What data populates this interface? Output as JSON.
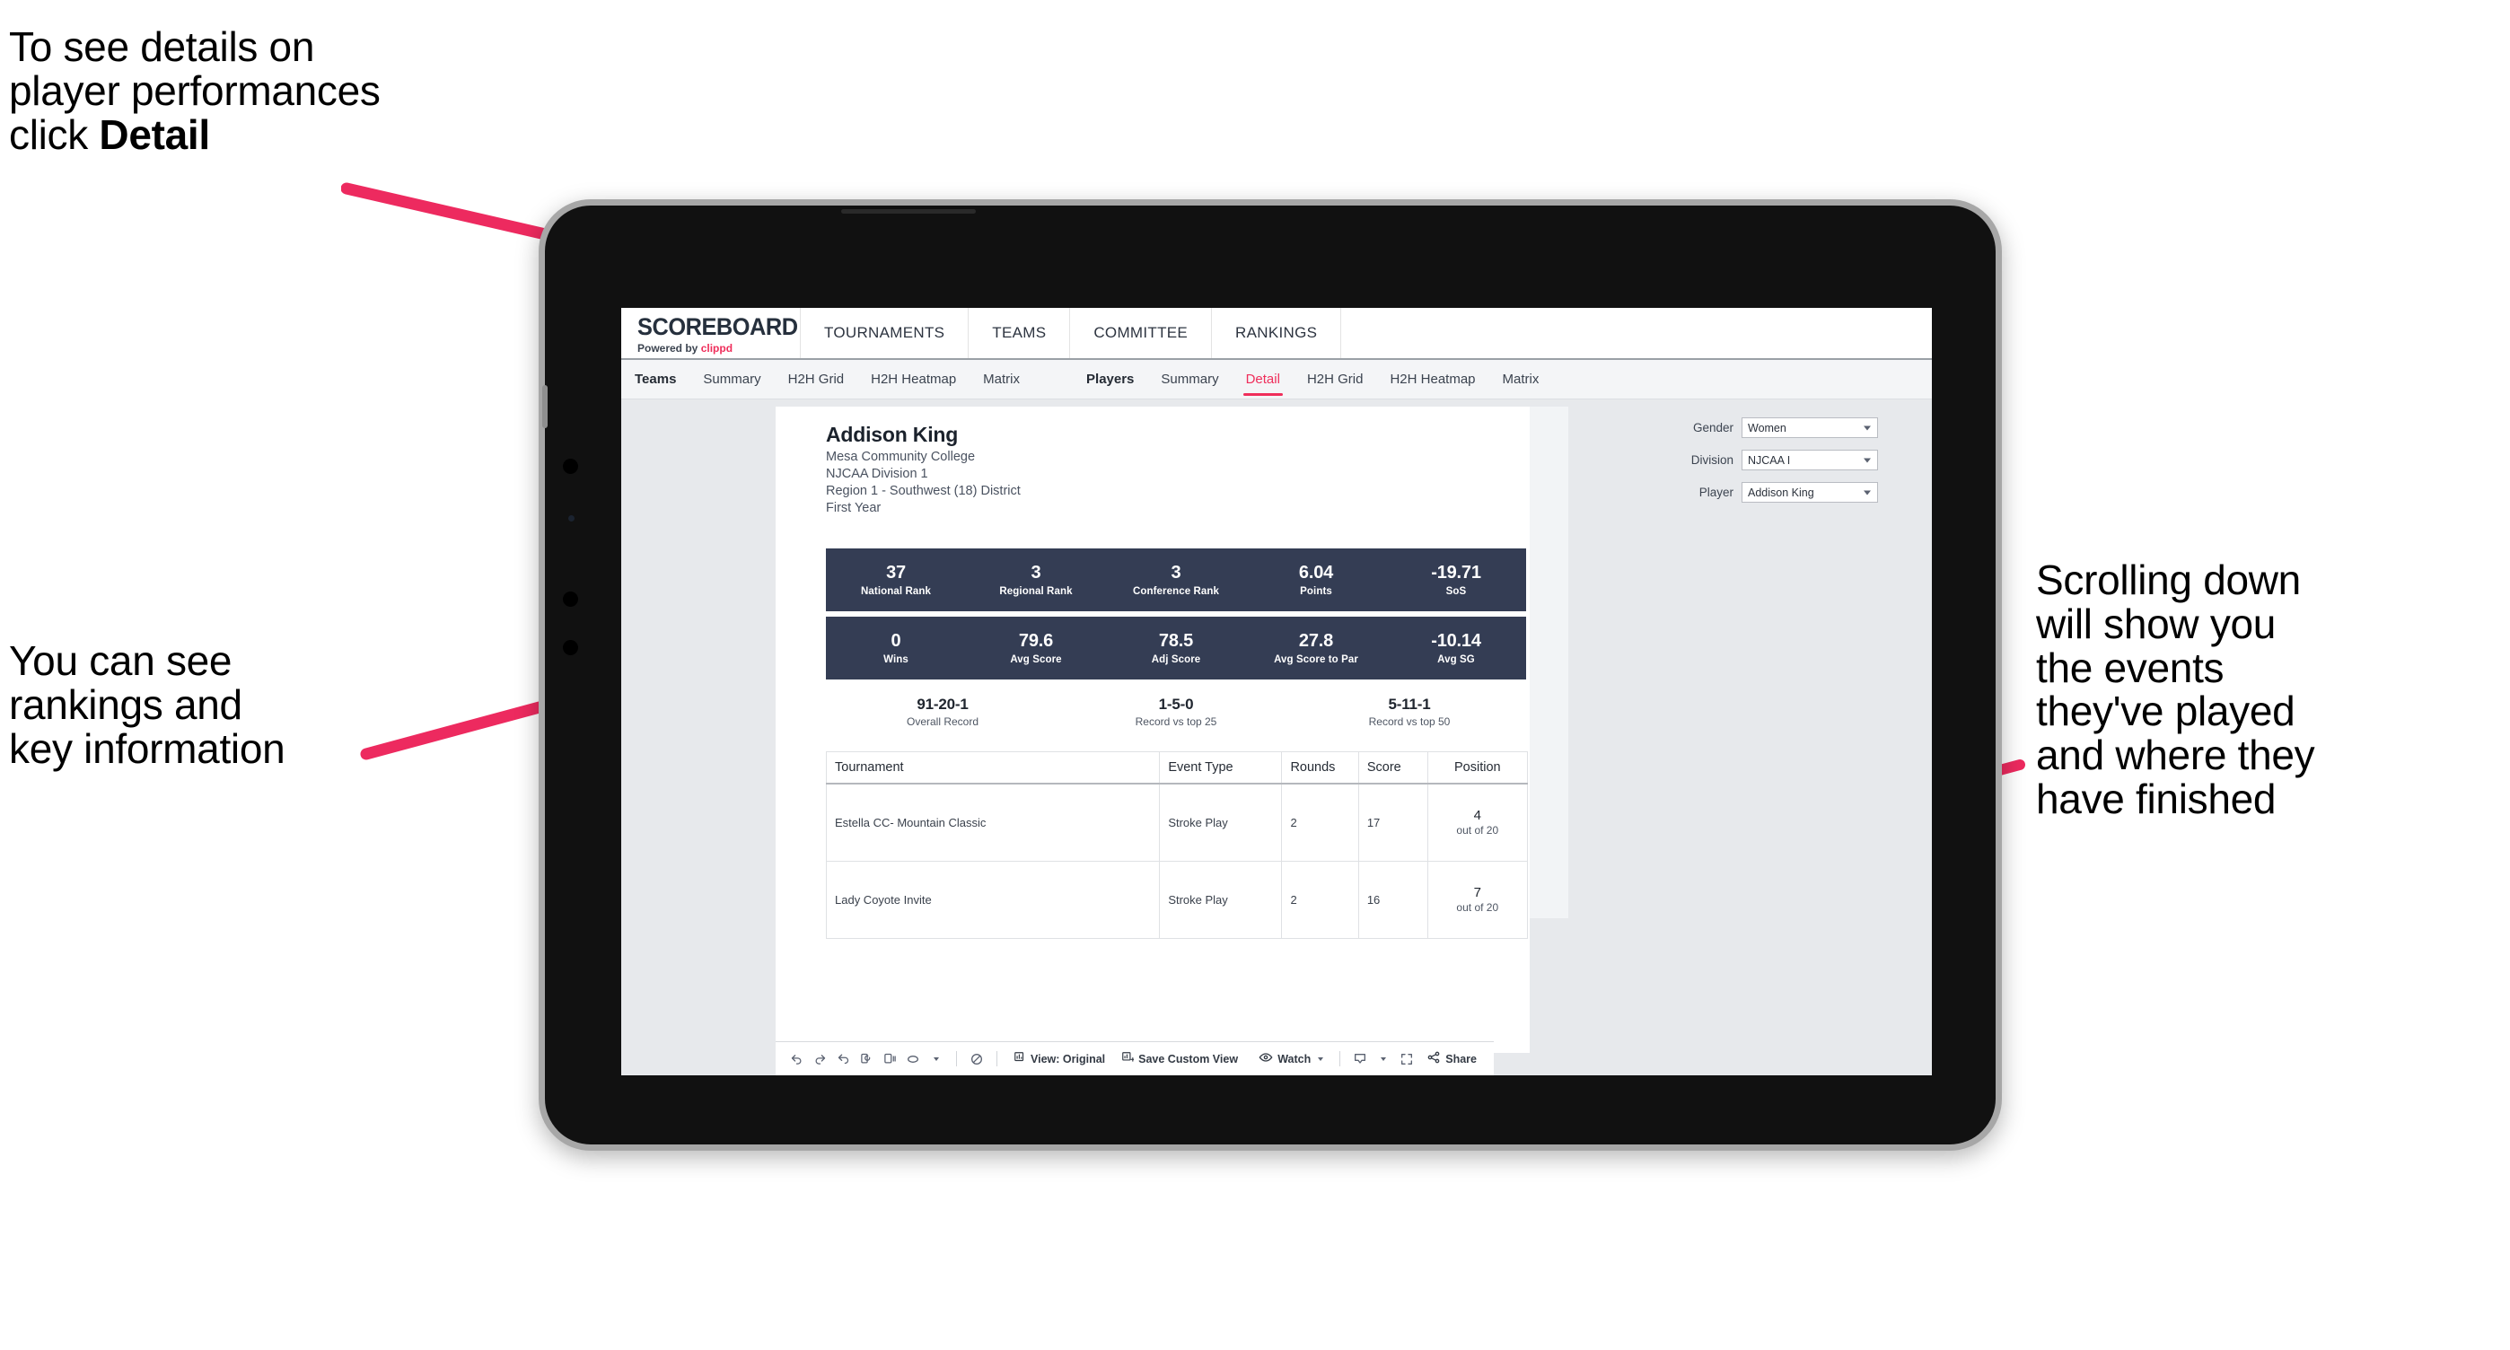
{
  "annotations": {
    "detail_hint_prefix": "To see details on\nplayer performances\nclick ",
    "detail_hint_bold": "Detail",
    "rankings_hint": "You can see\nrankings and\nkey information",
    "scroll_hint": "Scrolling down\nwill show you\nthe events\nthey've played\nand where they\nhave finished",
    "arrow_color": "#ED2A5F"
  },
  "app": {
    "logo_word": "SCOREBOARD",
    "logo_sub_prefix": "Powered by ",
    "logo_brand": "clippd",
    "top_nav": [
      "TOURNAMENTS",
      "TEAMS",
      "COMMITTEE",
      "RANKINGS"
    ],
    "sub_nav_teams": [
      "Teams",
      "Summary",
      "H2H Grid",
      "H2H Heatmap",
      "Matrix"
    ],
    "sub_nav_players": [
      "Players",
      "Summary",
      "Detail",
      "H2H Grid",
      "H2H Heatmap",
      "Matrix"
    ],
    "active_sub_tab": "Detail",
    "accent_color": "#EF2E5B"
  },
  "player": {
    "name": "Addison King",
    "school": "Mesa Community College",
    "division": "NJCAA Division 1",
    "region": "Region 1 - Southwest (18) District",
    "year": "First Year"
  },
  "filters": [
    {
      "label": "Gender",
      "value": "Women"
    },
    {
      "label": "Division",
      "value": "NJCAA I"
    },
    {
      "label": "Player",
      "value": "Addison King"
    }
  ],
  "stats_row_1": [
    {
      "value": "37",
      "label": "National Rank"
    },
    {
      "value": "3",
      "label": "Regional Rank"
    },
    {
      "value": "3",
      "label": "Conference Rank"
    },
    {
      "value": "6.04",
      "label": "Points"
    },
    {
      "value": "-19.71",
      "label": "SoS"
    }
  ],
  "stats_row_2": [
    {
      "value": "0",
      "label": "Wins"
    },
    {
      "value": "79.6",
      "label": "Avg Score"
    },
    {
      "value": "78.5",
      "label": "Adj Score"
    },
    {
      "value": "27.8",
      "label": "Avg Score to Par"
    },
    {
      "value": "-10.14",
      "label": "Avg SG"
    }
  ],
  "records": [
    {
      "value": "91-20-1",
      "label": "Overall Record"
    },
    {
      "value": "1-5-0",
      "label": "Record vs top 25"
    },
    {
      "value": "5-11-1",
      "label": "Record vs top 50"
    }
  ],
  "events_table": {
    "headers": [
      "Tournament",
      "Event Type",
      "Rounds",
      "Score",
      "Position"
    ],
    "rows": [
      {
        "tournament": "Estella CC- Mountain Classic",
        "event_type": "Stroke Play",
        "rounds": "2",
        "score": "17",
        "position_num": "4",
        "position_of": "out of 20"
      },
      {
        "tournament": "Lady Coyote Invite",
        "event_type": "Stroke Play",
        "rounds": "2",
        "score": "16",
        "position_num": "7",
        "position_of": "out of 20"
      }
    ]
  },
  "toolbar": {
    "view_label": "View: Original",
    "save_label": "Save Custom View",
    "watch_label": "Watch",
    "share_label": "Share"
  }
}
